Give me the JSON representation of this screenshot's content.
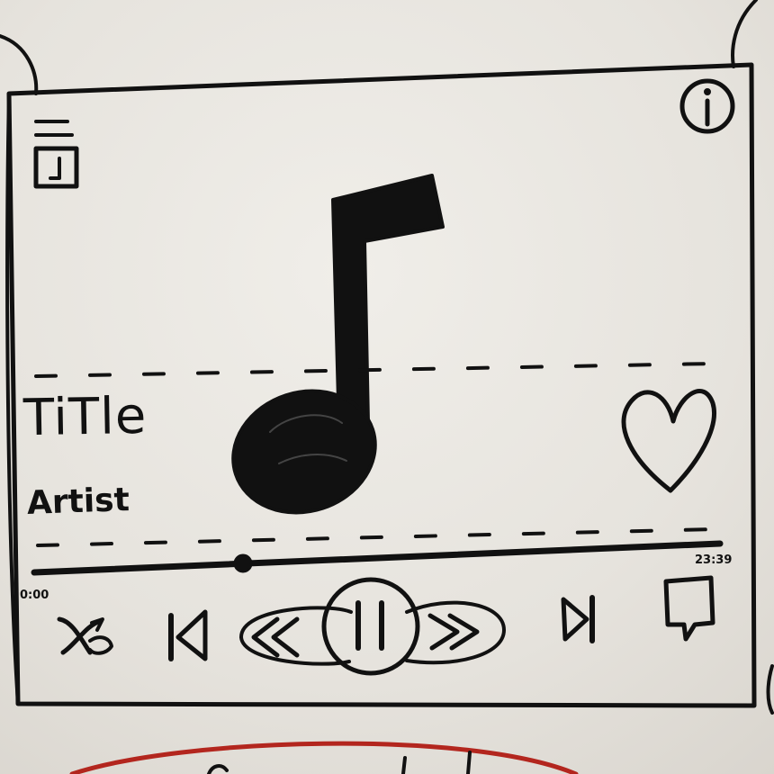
{
  "track": {
    "title": "TiTle",
    "artist": "Artist"
  },
  "progress": {
    "elapsed": "0:00",
    "duration": "23:39",
    "fraction": 0.32
  },
  "icons": {
    "header_left": "playlist-icon",
    "header_right": "info-icon",
    "artwork": "music-note-icon",
    "favorite": "heart-icon",
    "controls": [
      "shuffle-icon",
      "previous-icon",
      "rewind-icon",
      "pause-icon",
      "fast-forward-icon",
      "next-icon",
      "queue-icon"
    ]
  },
  "colors": {
    "ink": "#111111",
    "board": "#e7e4de",
    "marker_red": "#b3261e"
  }
}
